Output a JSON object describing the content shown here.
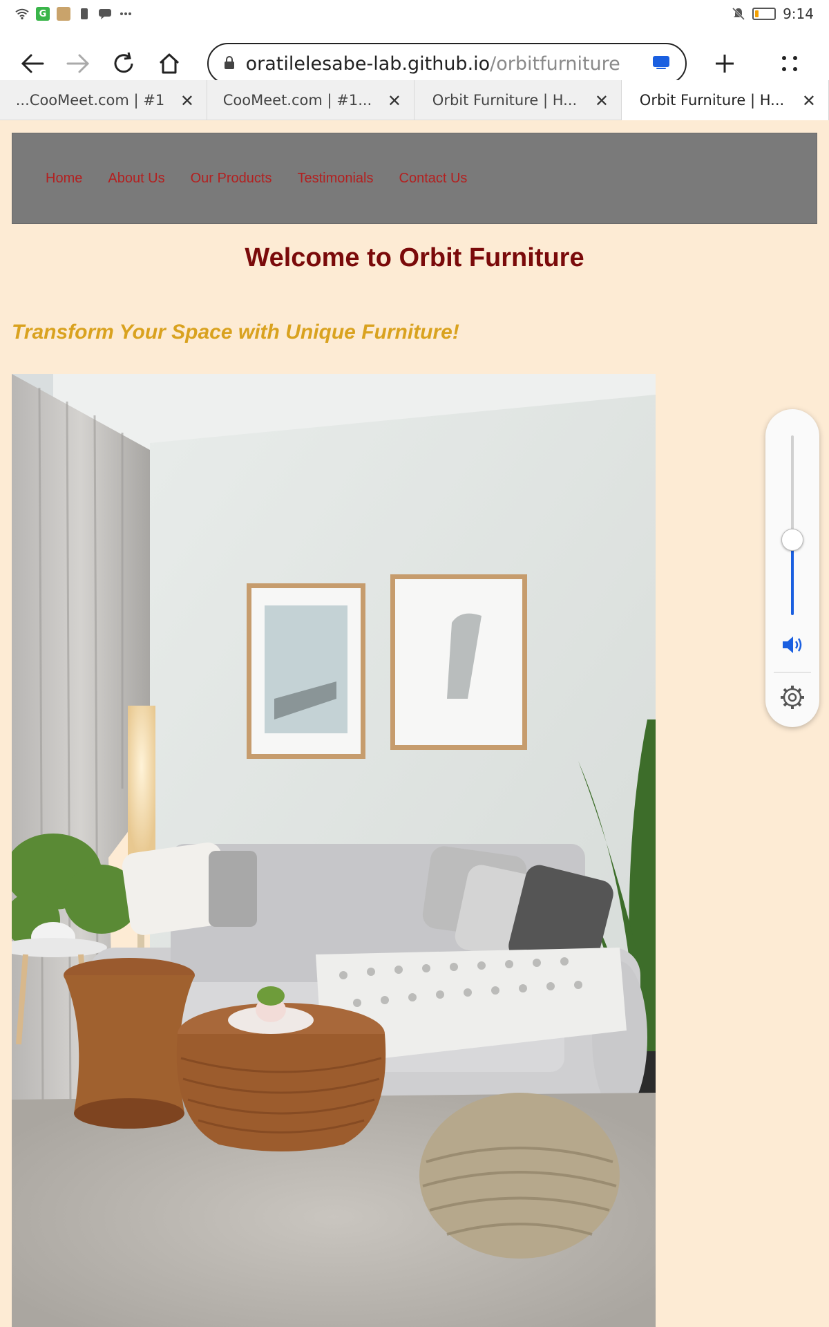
{
  "status_bar": {
    "time": "9:14",
    "battery_level": 0.2,
    "icons": [
      "wifi-icon",
      "grammarly-app-icon",
      "gallery-app-icon",
      "sim-icon",
      "chat-icon",
      "more-icon",
      "bell-muted-icon",
      "battery-icon"
    ]
  },
  "browser": {
    "url_domain": "oratilelesabe-lab.github.io",
    "url_path": "/orbitfurniture",
    "tabs": [
      {
        "label": "CooMeet.com | #1...",
        "active": false
      },
      {
        "label": "CooMeet.com | #1...",
        "active": false
      },
      {
        "label": "Orbit Furniture | H...",
        "active": false
      },
      {
        "label": "Orbit Furniture | H...",
        "active": true
      }
    ]
  },
  "site": {
    "nav": [
      "Home",
      "About Us",
      "Our Products",
      "Testimonials",
      "Contact Us"
    ],
    "title": "Welcome to Orbit Furniture",
    "tagline": "Transform Your Space with Unique Furniture!"
  },
  "volume_panel": {
    "level": 0.42
  },
  "colors": {
    "page_bg": "#fdebd4",
    "nav_bg": "#7a7a7a",
    "nav_link": "#b32020",
    "title": "#7a0a0a",
    "tagline": "#d9a21f",
    "accent": "#1a5fe0"
  }
}
